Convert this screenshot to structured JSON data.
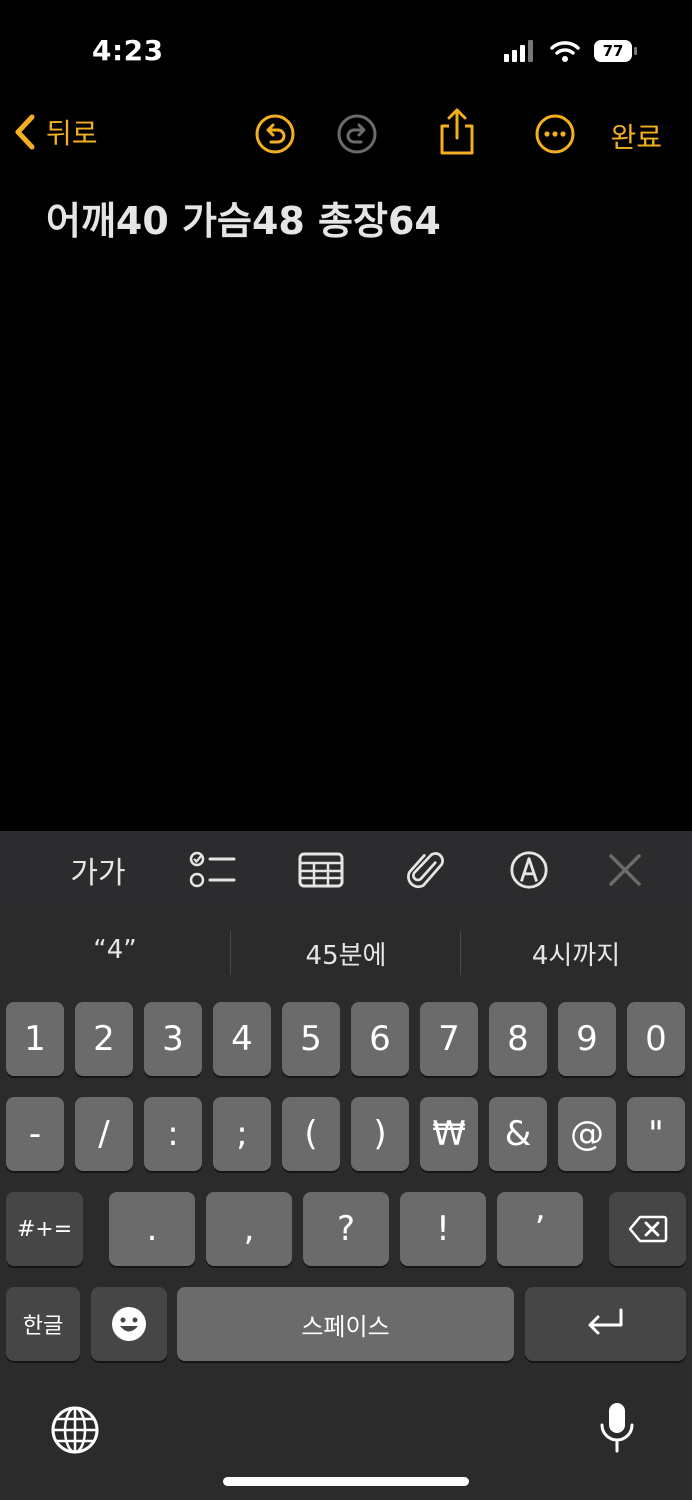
{
  "status": {
    "time": "4:23",
    "battery": "77"
  },
  "nav": {
    "back_label": "뒤로",
    "done_label": "완료"
  },
  "note": {
    "text": "어깨40 가슴48 총장64"
  },
  "format_toolbar": {
    "text_style_label": "가가"
  },
  "suggestions": [
    "“4”",
    "45분에",
    "4시까지"
  ],
  "keyboard": {
    "row1": [
      "1",
      "2",
      "3",
      "4",
      "5",
      "6",
      "7",
      "8",
      "9",
      "0"
    ],
    "row2": [
      "-",
      "/",
      ":",
      ";",
      "(",
      ")",
      "₩",
      "&",
      "@",
      "\""
    ],
    "row3": [
      ".",
      ",",
      "?",
      "!",
      "’"
    ],
    "more_symbols_label": "#+=",
    "language_label": "한글",
    "space_label": "스페이스"
  },
  "colors": {
    "accent": "#f2b021",
    "background": "#000000",
    "keyboard_bg": "#2b2b2b",
    "key": "#6b6b6b",
    "key_dark": "#464646"
  }
}
